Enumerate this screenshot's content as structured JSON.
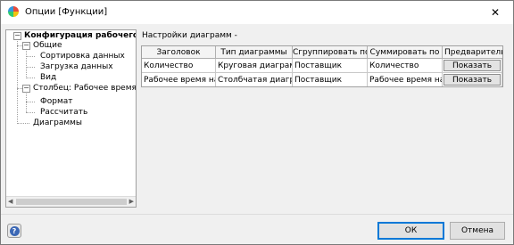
{
  "window": {
    "title": "Опции [Функции]",
    "close": "✕"
  },
  "tree": {
    "items": [
      {
        "label": "Конфигурация рабочего листа",
        "level": 0,
        "expander": "−",
        "bold": true
      },
      {
        "label": "Общие",
        "level": 1,
        "expander": "−"
      },
      {
        "label": "Сортировка данных",
        "level": 2
      },
      {
        "label": "Загрузка данных",
        "level": 2
      },
      {
        "label": "Вид",
        "level": 2
      },
      {
        "label": "Столбец: Рабочее время на",
        "level": 1,
        "expander": "−"
      },
      {
        "label": "Формат",
        "level": 2
      },
      {
        "label": "Рассчитать",
        "level": 2
      },
      {
        "label": "Диаграммы",
        "level": 1
      }
    ]
  },
  "settings": {
    "section_label": "Настройки диаграмм -",
    "columns": [
      "Заголовок",
      "Тип диаграммы",
      "Сгруппировать по",
      "Суммировать по",
      "Предварительно"
    ],
    "rows": [
      {
        "title": "Количество",
        "type": "Круговая диаграмма",
        "group_by": "Поставщик",
        "sum_by": "Количество",
        "preview": "Показать"
      },
      {
        "title": "Рабочее время на",
        "type": "Столбчатая диаграмма",
        "group_by": "Поставщик",
        "sum_by": "Рабочее время на",
        "preview": "Показать"
      }
    ]
  },
  "footer": {
    "help": "?",
    "ok": "ОК",
    "cancel": "Отмена"
  }
}
